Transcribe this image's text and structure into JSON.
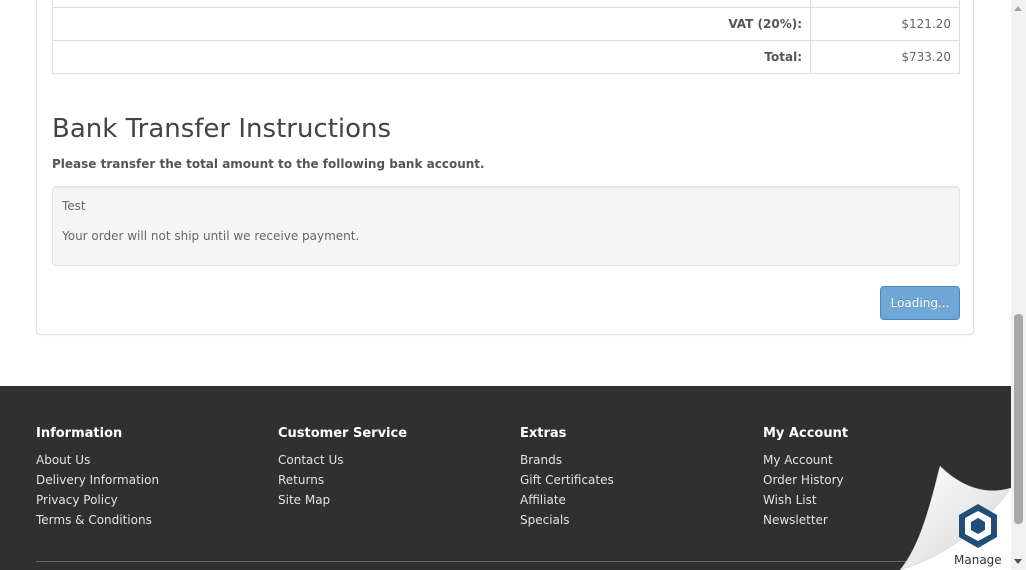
{
  "totals": {
    "rows": [
      {
        "label": "VAT (20%):",
        "value": "$121.20"
      },
      {
        "label": "Total:",
        "value": "$733.20"
      }
    ]
  },
  "bank": {
    "title": "Bank Transfer Instructions",
    "subtitle": "Please transfer the total amount to the following bank account.",
    "account_info": "Test",
    "notice": "Your order will not ship until we receive payment."
  },
  "confirm_button": {
    "label": "Loading..."
  },
  "footer": {
    "columns": [
      {
        "heading": "Information",
        "links": [
          "About Us",
          "Delivery Information",
          "Privacy Policy",
          "Terms & Conditions"
        ]
      },
      {
        "heading": "Customer Service",
        "links": [
          "Contact Us",
          "Returns",
          "Site Map"
        ]
      },
      {
        "heading": "Extras",
        "links": [
          "Brands",
          "Gift Certificates",
          "Affiliate",
          "Specials"
        ]
      },
      {
        "heading": "My Account",
        "links": [
          "My Account",
          "Order History",
          "Wish List",
          "Newsletter"
        ]
      }
    ]
  },
  "manage_widget": {
    "label": "Manage",
    "icon": "hexagon-logo-icon",
    "accent": "#1f4e79"
  },
  "colors": {
    "footer_bg": "#303030",
    "button": "#6fa7d6",
    "well_bg": "#f5f5f5"
  }
}
